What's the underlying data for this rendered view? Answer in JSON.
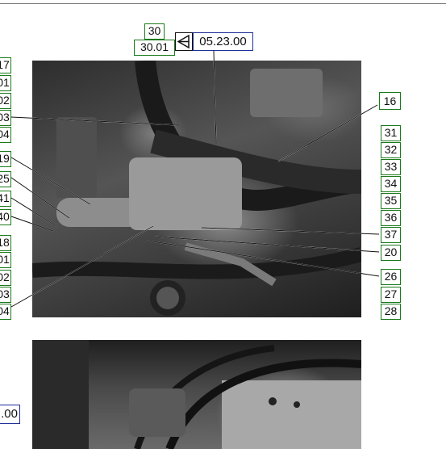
{
  "header": {
    "callout_top": "30",
    "callout_sub": "30.01",
    "ref_icon": "arrow-triangle-icon",
    "ref_code": "05.23.00"
  },
  "left_callouts": {
    "upper": [
      "17",
      "01",
      "02",
      "03",
      "04",
      "19",
      "25",
      "41",
      "40"
    ],
    "lower": [
      "18",
      "01",
      "02",
      "03",
      "04"
    ]
  },
  "right_callouts": {
    "single": "16",
    "column": [
      "31",
      "32",
      "33",
      "34",
      "35",
      "36",
      "37",
      "20",
      "26",
      "27",
      "28"
    ]
  },
  "bottom_ref": ".00",
  "colors": {
    "callout_border": "#1a7a1a",
    "ref_border": "#1f2f9a",
    "leader_line": "#ffffff"
  }
}
